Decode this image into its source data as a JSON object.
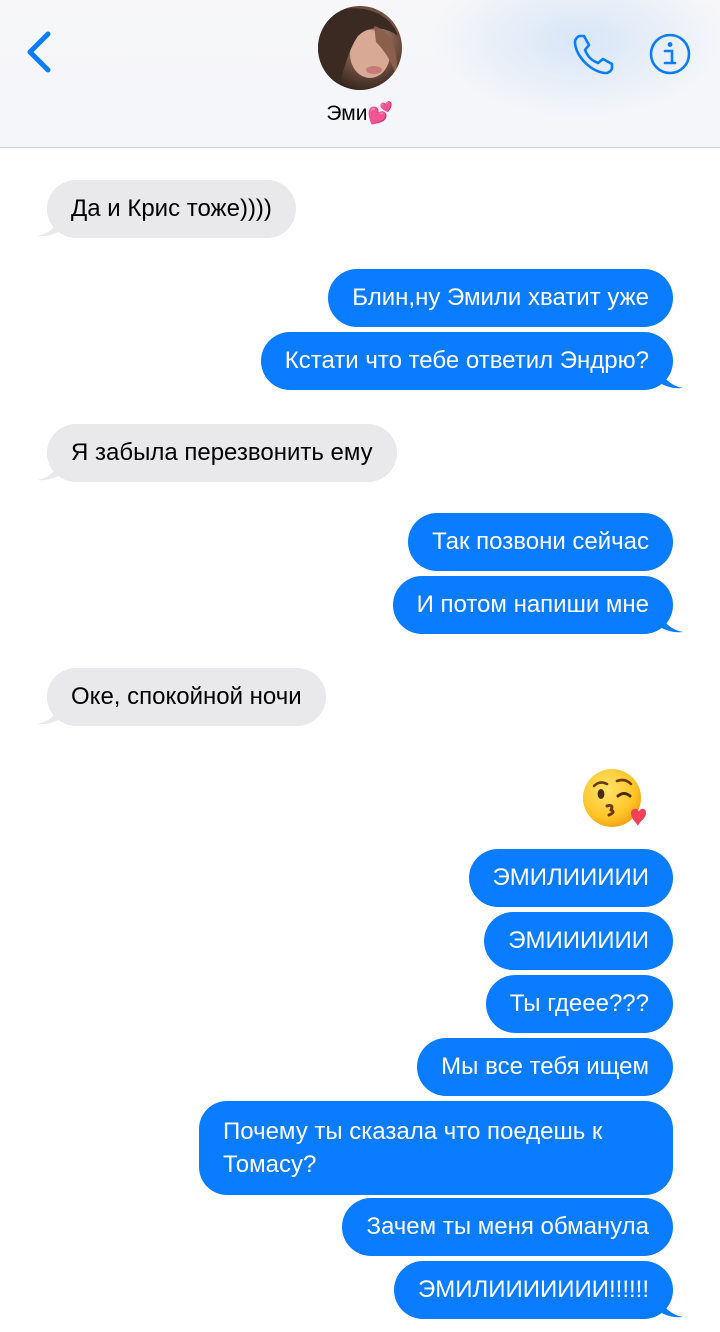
{
  "header": {
    "contact_name": "Эми💕"
  },
  "messages": [
    {
      "from": "them",
      "text": "Да и Крис тоже))))"
    },
    {
      "from": "me",
      "text": "Блин,ну Эмили хватит уже"
    },
    {
      "from": "me",
      "text": "Кстати что тебе ответил Эндрю?"
    },
    {
      "from": "them",
      "text": "Я забыла перезвонить ему"
    },
    {
      "from": "me",
      "text": "Так позвони сейчас"
    },
    {
      "from": "me",
      "text": "И потом напиши мне"
    },
    {
      "from": "them",
      "text": "Оке, спокойной ночи"
    },
    {
      "from": "me",
      "emoji": "face-blowing-a-kiss"
    },
    {
      "from": "me",
      "text": "ЭМИЛИИИИИ"
    },
    {
      "from": "me",
      "text": "ЭМИИИИИИ"
    },
    {
      "from": "me",
      "text": "Ты гдеее???"
    },
    {
      "from": "me",
      "text": "Мы все тебя ищем"
    },
    {
      "from": "me",
      "text": "Почему ты сказала что поедешь к Томасу?"
    },
    {
      "from": "me",
      "text": "Зачем ты меня обманула"
    },
    {
      "from": "me",
      "text": "ЭМИЛИИИИИИИ!!!!!!"
    }
  ],
  "icons": {
    "back": "chevron-left-icon",
    "phone": "phone-icon",
    "info": "info-icon",
    "emoji": "kissing-face-emoji-icon"
  },
  "colors": {
    "accent": "#0a7cff",
    "incoming_bubble": "#e9e9eb",
    "icon_blue": "#0a7cff"
  }
}
